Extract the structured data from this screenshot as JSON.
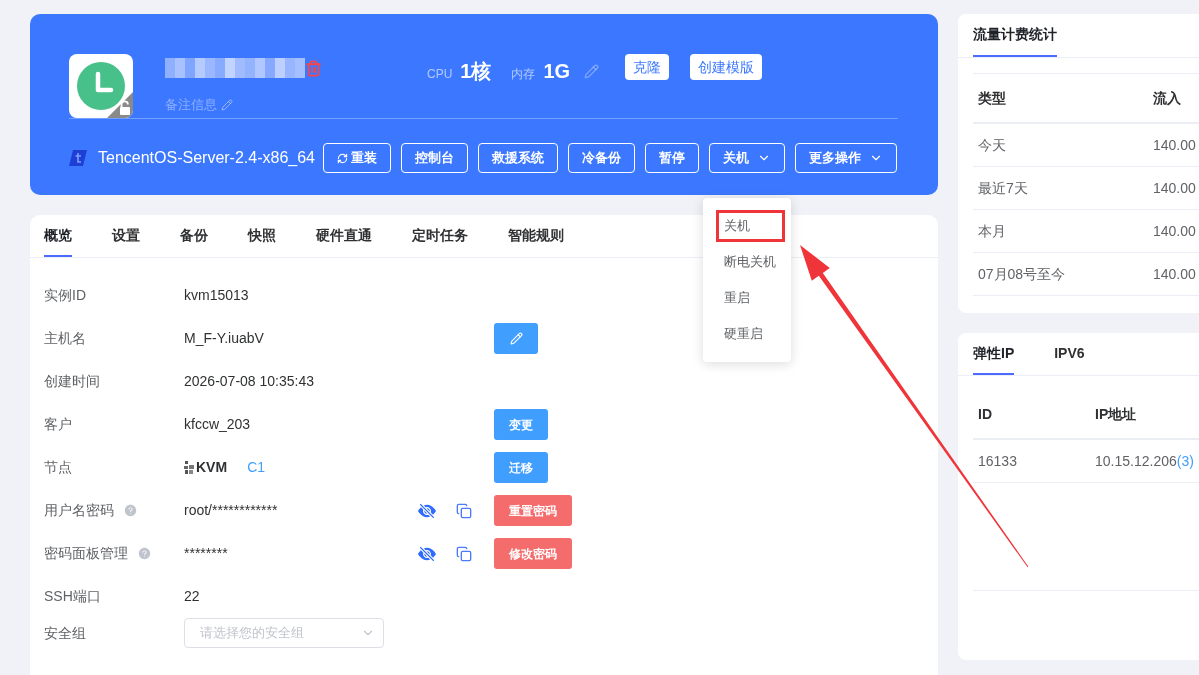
{
  "header": {
    "remark": "备注信息",
    "specs": [
      {
        "label": "CPU",
        "value": "1核"
      },
      {
        "label": "内存",
        "value": "1G"
      }
    ],
    "quick_actions": [
      "克隆",
      "创建模版"
    ],
    "os": "TencentOS-Server-2.4-x86_64",
    "actions": [
      {
        "label": "重装",
        "kind": "refresh"
      },
      {
        "label": "控制台",
        "kind": "plain"
      },
      {
        "label": "救援系统",
        "kind": "plain"
      },
      {
        "label": "冷备份",
        "kind": "plain"
      },
      {
        "label": "暂停",
        "kind": "plain"
      },
      {
        "label": "关机",
        "kind": "dropdown",
        "expanded": true,
        "menu": [
          {
            "label": "关机",
            "annotated": true
          },
          {
            "label": "断电关机",
            "annotated": false
          },
          {
            "label": "重启",
            "annotated": false
          },
          {
            "label": "硬重启",
            "annotated": false
          }
        ]
      },
      {
        "label": "更多操作",
        "kind": "dropdown",
        "expanded": false
      }
    ]
  },
  "tabs": [
    {
      "label": "概览",
      "selected": true
    },
    {
      "label": "设置",
      "selected": false
    },
    {
      "label": "备份",
      "selected": false
    },
    {
      "label": "快照",
      "selected": false
    },
    {
      "label": "硬件直通",
      "selected": false
    },
    {
      "label": "定时任务",
      "selected": false
    },
    {
      "label": "智能规则",
      "selected": false
    }
  ],
  "details": [
    {
      "label": "实例ID",
      "help": false,
      "kind": "text",
      "value": "kvm15013",
      "masked": false
    },
    {
      "label": "主机名",
      "help": false,
      "kind": "text",
      "value": "M_F-Y.iuabV",
      "masked": false,
      "action": {
        "kind": "edit"
      }
    },
    {
      "label": "创建时间",
      "help": false,
      "kind": "text",
      "value": "2026-07-08 10:35:43",
      "masked": false
    },
    {
      "label": "客户",
      "help": false,
      "kind": "text",
      "value": "kfccw_203",
      "masked": false,
      "action": {
        "kind": "primary",
        "label": "变更"
      }
    },
    {
      "label": "节点",
      "help": false,
      "kind": "node",
      "value": "KVM",
      "link": "C1",
      "masked": false,
      "action": {
        "kind": "primary",
        "label": "迁移"
      }
    },
    {
      "label": "用户名密码",
      "help": true,
      "kind": "text",
      "value": "root/************",
      "masked": true,
      "action": {
        "kind": "danger",
        "label": "重置密码"
      }
    },
    {
      "label": "密码面板管理",
      "help": true,
      "kind": "text",
      "value": "********",
      "masked": true,
      "action": {
        "kind": "danger",
        "label": "修改密码"
      }
    },
    {
      "label": "SSH端口",
      "help": false,
      "kind": "text",
      "value": "22",
      "masked": false
    },
    {
      "label": "安全组",
      "help": false,
      "kind": "select",
      "placeholder": "请选择您的安全组",
      "masked": false
    }
  ],
  "traffic": {
    "tabs": [
      {
        "label": "流量计费统计",
        "selected": true
      }
    ],
    "columns": [
      "类型",
      "流入"
    ],
    "rows": [
      [
        "今天",
        "140.00"
      ],
      [
        "最近7天",
        "140.00"
      ],
      [
        "本月",
        "140.00"
      ],
      [
        "07月08号至今",
        "140.00"
      ]
    ]
  },
  "ip": {
    "tabs": [
      {
        "label": "弹性IP",
        "selected": true
      },
      {
        "label": "IPV6",
        "selected": false
      }
    ],
    "columns": [
      "ID",
      "IP地址"
    ],
    "rows": [
      {
        "id": "16133",
        "ip": "10.15.12.206",
        "count": "(3)"
      }
    ]
  },
  "annotations": [
    {
      "kind": "arrow"
    }
  ]
}
